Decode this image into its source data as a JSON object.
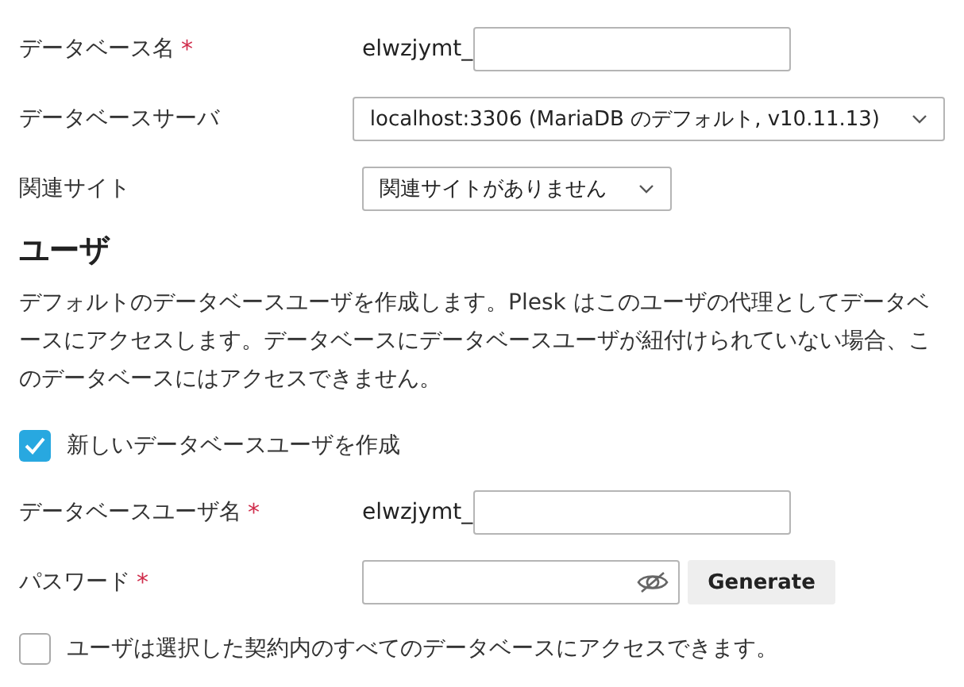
{
  "fields": [
    {
      "kind": "prefixed",
      "label": "データベース名",
      "required_mark": "*",
      "prefix": "elwzjymt_"
    },
    {
      "kind": "select",
      "label": "データベースサーバ",
      "value": "localhost:3306 (MariaDB のデフォルト, v10.11.13)"
    },
    {
      "kind": "select",
      "label": "関連サイト",
      "value": "関連サイトがありません"
    }
  ],
  "user_section": {
    "heading": "ユーザ",
    "description": "デフォルトのデータベースユーザを作成します。Plesk はこのユーザの代理としてデータベースにアクセスします。データベースにデータベースユーザが紐付けられていない場合、このデータベースにはアクセスできません。",
    "create_user": {
      "label": "新しいデータベースユーザを作成",
      "checked": true
    },
    "fields": [
      {
        "kind": "prefixed",
        "label": "データベースユーザ名",
        "required_mark": "*",
        "prefix": "elwzjymt_"
      },
      {
        "kind": "password",
        "label": "パスワード",
        "required_mark": "*",
        "button": "Generate"
      }
    ],
    "access_all": {
      "label": "ユーザは選択した契約内のすべてのデータベースにアクセスできます。",
      "checked": false
    }
  }
}
